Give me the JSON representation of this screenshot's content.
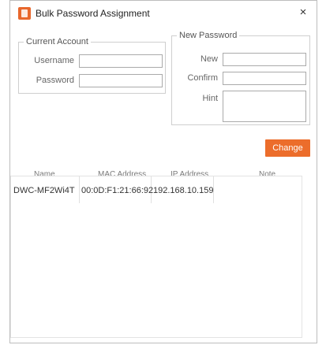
{
  "window": {
    "title": "Bulk Password Assignment",
    "close_glyph": "×"
  },
  "current_account": {
    "legend": "Current Account",
    "username_label": "Username",
    "username_value": "",
    "password_label": "Password",
    "password_value": ""
  },
  "new_password": {
    "legend": "New Password",
    "new_label": "New",
    "new_value": "",
    "confirm_label": "Confirm",
    "confirm_value": "",
    "hint_label": "Hint",
    "hint_value": ""
  },
  "change_button": {
    "label": "Change"
  },
  "table": {
    "headers": [
      "Name",
      "MAC Address",
      "IP Address",
      "Note"
    ],
    "rows": [
      {
        "name": "DWC-MF2Wi4T",
        "mac": "00:0D:F1:21:66:92",
        "ip": "192.168.10.159",
        "note": ""
      }
    ]
  },
  "colors": {
    "accent": "#ec6d2b",
    "border": "#cfcfcf"
  },
  "icons": {
    "app": "app-logo-icon",
    "close": "close-icon"
  }
}
